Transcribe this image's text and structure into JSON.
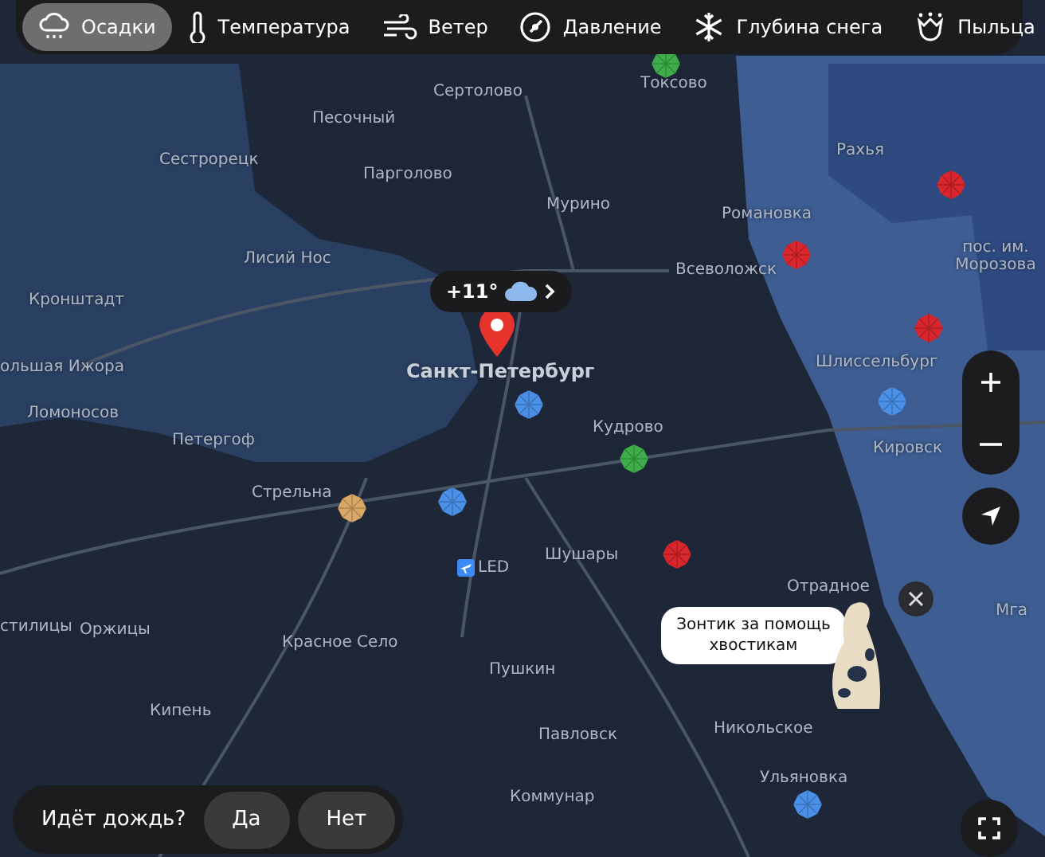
{
  "tabs": [
    {
      "label": "Осадки",
      "selected": true,
      "kind": "rain"
    },
    {
      "label": "Температура",
      "selected": false,
      "kind": "temp"
    },
    {
      "label": "Ветер",
      "selected": false,
      "kind": "wind"
    },
    {
      "label": "Давление",
      "selected": false,
      "kind": "pressure"
    },
    {
      "label": "Глубина снега",
      "selected": false,
      "kind": "snow"
    },
    {
      "label": "Пыльца",
      "selected": false,
      "kind": "pollen"
    }
  ],
  "places": [
    "Токсово",
    "Сертолово",
    "Песочный",
    "Рахья",
    "Сестрорецк",
    "Парголово",
    "Мурино",
    "Романовка",
    "Лисий Нос",
    "Всеволожск",
    "Кронштадт",
    "пос. им. Морозова",
    "ольшая Ижора",
    "Санкт-Петербург",
    "Шлиссельбург",
    "Ломоносов",
    "Кудрово",
    "Петергоф",
    "Кировск",
    "Стрельна",
    "Шушары",
    "Отрадное",
    "Мга",
    "стилицы",
    "Оржицы",
    "Красное Село",
    "Пушкин",
    "Кипень",
    "Никольское",
    "Павловск",
    "Ульяновка",
    "Коммунар"
  ],
  "airport": {
    "code": "LED"
  },
  "markers": [
    {
      "color": "#3fae4a"
    },
    {
      "color": "#d9262c"
    },
    {
      "color": "#d9262c"
    },
    {
      "color": "#d9262c"
    },
    {
      "color": "#4a90e8"
    },
    {
      "color": "#4a90e8"
    },
    {
      "color": "#3fae4a"
    },
    {
      "color": "#d9a766"
    },
    {
      "color": "#4a90e8"
    },
    {
      "color": "#d9262c"
    },
    {
      "color": "#4a90e8"
    }
  ],
  "weather_chip": {
    "temperature": "+11°"
  },
  "promo": {
    "text": "Зонтик за помощь хвостикам"
  },
  "rain_question": {
    "text": "Идёт дождь?",
    "buttons": [
      "Да",
      "Нет"
    ]
  }
}
